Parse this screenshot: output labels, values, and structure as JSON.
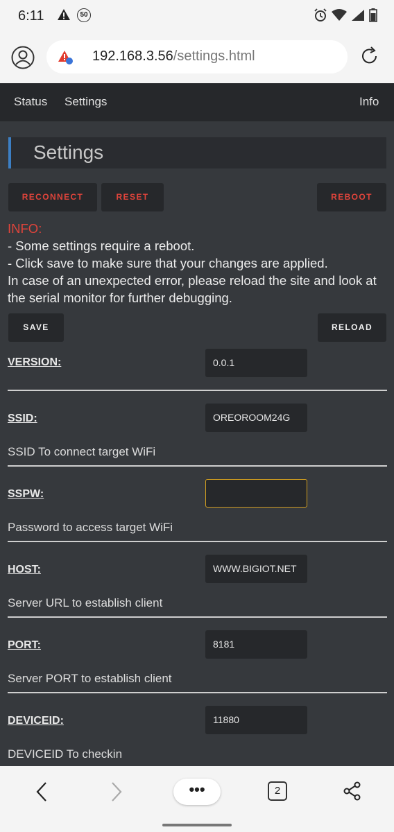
{
  "statusbar": {
    "time": "6:11",
    "notif_badge": "50"
  },
  "browser": {
    "url_host": "192.168.3.56",
    "url_path": "/settings.html",
    "tabs_count": "2",
    "menu_label": "•••"
  },
  "nav": {
    "status": "Status",
    "settings": "Settings",
    "info": "Info"
  },
  "page": {
    "title": "Settings",
    "buttons": {
      "reconnect": "RECONNECT",
      "reset": "RESET",
      "reboot": "REBOOT",
      "save": "SAVE",
      "reload": "RELOAD"
    },
    "info": {
      "title": "INFO:",
      "line1": "- Some settings require a reboot.",
      "line2": "- Click save to make sure that your changes are applied.",
      "line3": "In case of an unexpected error, please reload the site and look at the serial monitor for further debugging."
    },
    "fields": [
      {
        "label": "VERSION:",
        "value": "0.0.1",
        "desc": ""
      },
      {
        "label": "SSID:",
        "value": "OREOROOM24G",
        "desc": "SSID To connect target WiFi"
      },
      {
        "label": "SSPW:",
        "value": "",
        "desc": "Password to access target WiFi"
      },
      {
        "label": "HOST:",
        "value": "WWW.BIGIOT.NET",
        "desc": "Server URL to establish client"
      },
      {
        "label": "PORT:",
        "value": "8181",
        "desc": "Server PORT to establish client"
      },
      {
        "label": "DEVICEID:",
        "value": "11880",
        "desc": "DEVICEID To checkin"
      }
    ]
  },
  "colors": {
    "accent_red": "#e0443b",
    "accent_blue": "#3c7fc4",
    "focus_border": "#d4a020"
  }
}
